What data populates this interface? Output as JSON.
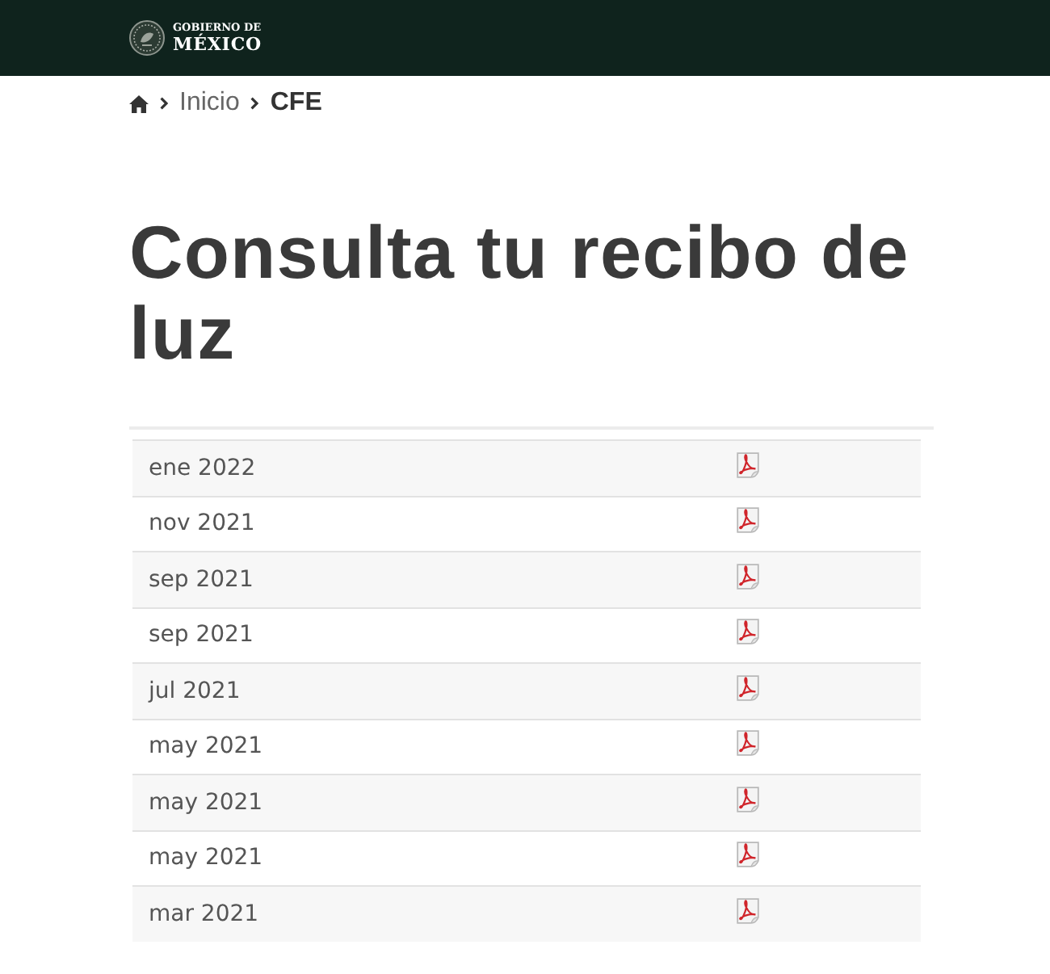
{
  "header": {
    "logo_top": "GOBIERNO DE",
    "logo_bottom": "MÉXICO"
  },
  "breadcrumb": [
    {
      "kind": "home"
    },
    {
      "kind": "link",
      "label": "Inicio"
    },
    {
      "kind": "current",
      "label": "CFE"
    }
  ],
  "title": "Consulta tu recibo de luz",
  "table": {
    "rows": [
      {
        "date": "ene 2022"
      },
      {
        "date": "nov 2021"
      },
      {
        "date": "sep 2021"
      },
      {
        "date": "sep 2021"
      },
      {
        "date": "jul 2021"
      },
      {
        "date": "may 2021"
      },
      {
        "date": "may 2021"
      },
      {
        "date": "may 2021"
      },
      {
        "date": "mar 2021"
      }
    ]
  }
}
